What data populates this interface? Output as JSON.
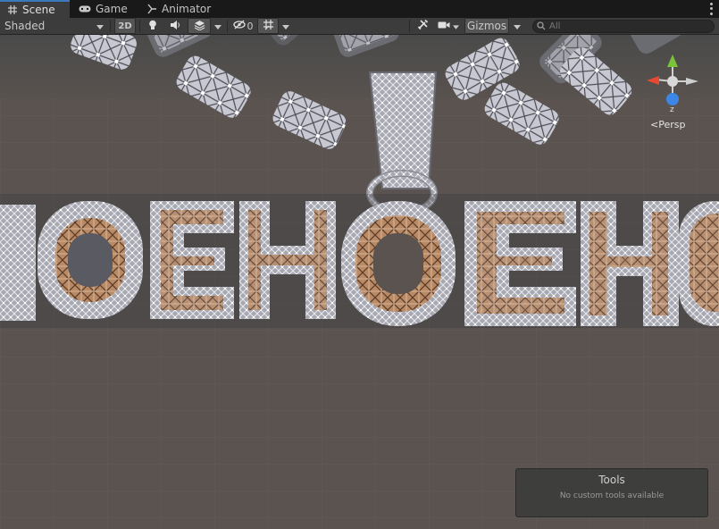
{
  "tabs": [
    {
      "label": "Scene",
      "icon": "scene-grid-icon",
      "active": true
    },
    {
      "label": "Game",
      "icon": "gamepad-icon",
      "active": false
    },
    {
      "label": "Animator",
      "icon": "animator-icon",
      "active": false
    }
  ],
  "toolbar": {
    "shading_mode": "Shaded",
    "mode_2d_label": "2D",
    "hidden_count": "0",
    "gizmos_label": "Gizmos",
    "search_placeholder": "All"
  },
  "viewport": {
    "projection_label": "Persp",
    "pendant_text": "HOEHOEHO"
  },
  "tools_overlay": {
    "title": "Tools",
    "message": "No custom tools available"
  },
  "colors": {
    "active_tab_accent": "#3a79bb",
    "axis_y": "#7bc43a",
    "axis_x": "#e8482f",
    "axis_z": "#3c87e6",
    "background_ground": "#5a534f"
  }
}
